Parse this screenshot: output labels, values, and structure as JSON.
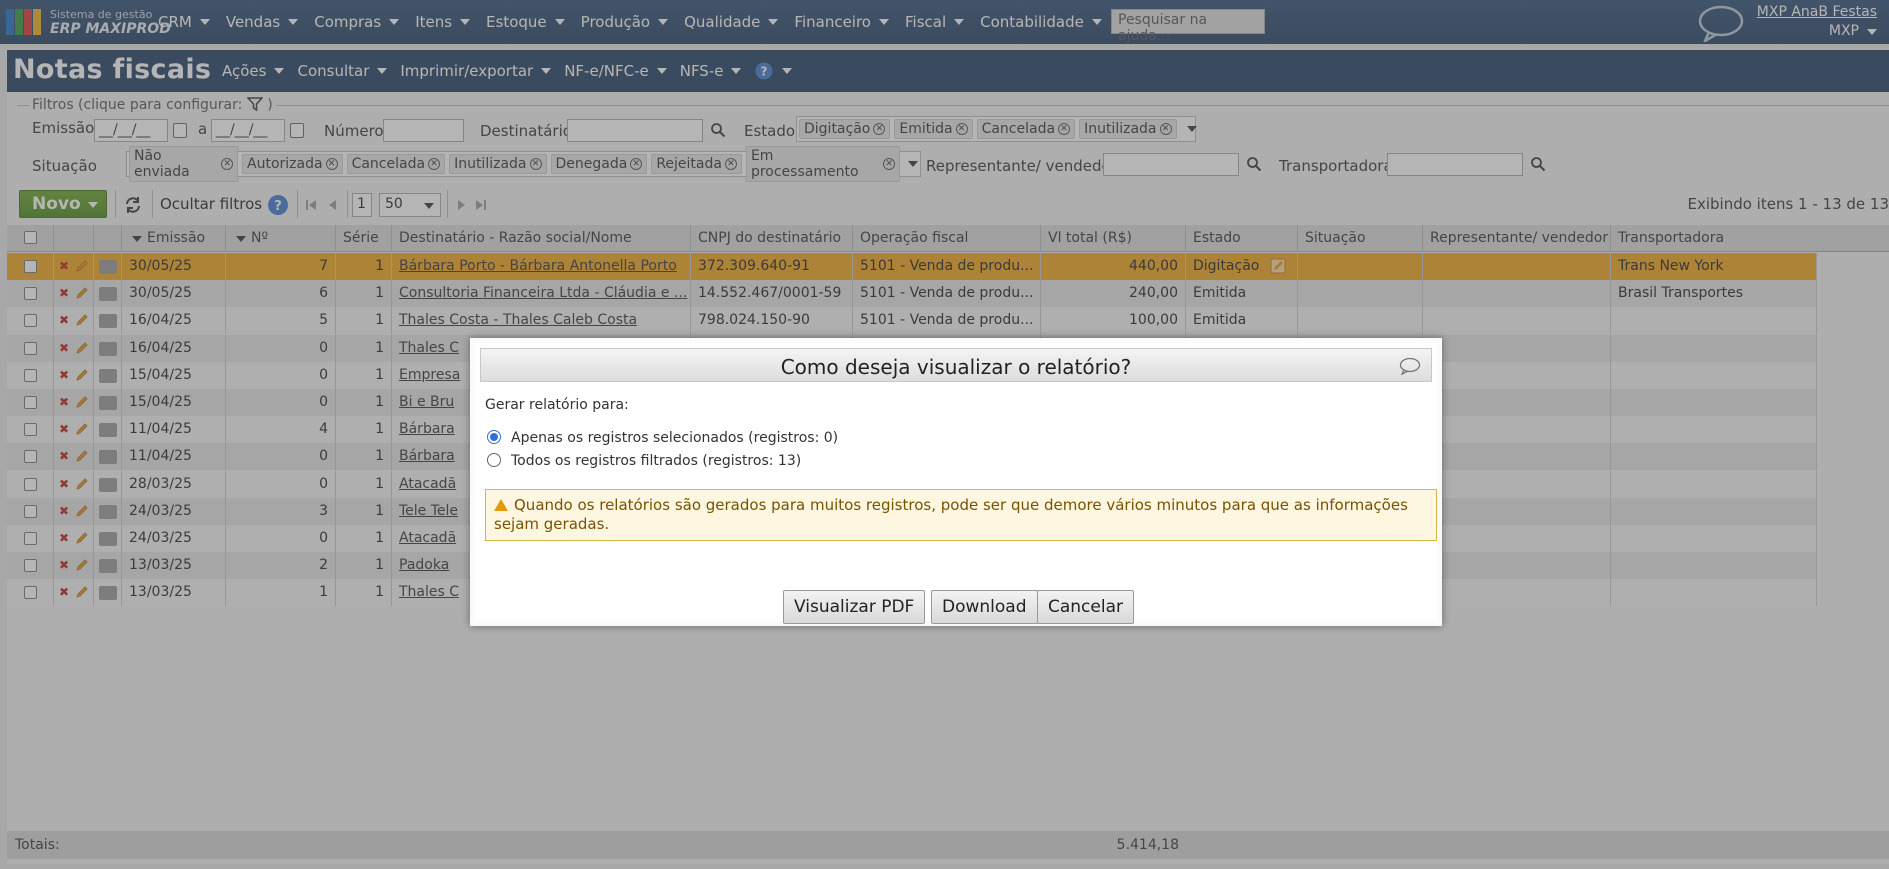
{
  "topbar": {
    "logo_sub": "Sistema de gestão",
    "logo_main": "ERP MAXIPROD",
    "nav": [
      "CRM",
      "Vendas",
      "Compras",
      "Itens",
      "Estoque",
      "Produção",
      "Qualidade",
      "Financeiro",
      "Fiscal",
      "Contabilidade"
    ],
    "help_search_placeholder": "Pesquisar na ajuda...",
    "user_name": "MXP AnaB Festas",
    "company": "MXP"
  },
  "page": {
    "title": "Notas fiscais",
    "menu": [
      "Ações",
      "Consultar",
      "Imprimir/exportar",
      "NF-e/NFC-e",
      "NFS-e"
    ]
  },
  "filters": {
    "legend": "Filtros (clique para configurar:",
    "legend_close": ")",
    "emissao_label": "Emissão",
    "date_placeholder": "__/__/__",
    "a_label": "a",
    "numero_label": "Número",
    "destinatario_label": "Destinatário",
    "estado_label": "Estado",
    "estado_tags": [
      "Digitação",
      "Emitida",
      "Cancelada",
      "Inutilizada"
    ],
    "situacao_label": "Situação",
    "situacao_tags": [
      "Não enviada",
      "Autorizada",
      "Cancelada",
      "Inutilizada",
      "Denegada",
      "Rejeitada",
      "Em processamento"
    ],
    "representante_label": "Representante/ vendedor",
    "transportadora_label": "Transportadora"
  },
  "toolbar": {
    "novo_label": "Novo",
    "hide_filters_label": "Ocultar filtros",
    "page_number": "1",
    "page_size": "50",
    "showing": "Exibindo itens 1 - 13 de 13"
  },
  "grid": {
    "headers": {
      "emissao": "Emissão",
      "numero": "Nº",
      "serie": "Série",
      "destinatario": "Destinatário - Razão social/Nome",
      "cnpj": "CNPJ do destinatário",
      "operacao": "Operação fiscal",
      "total": "Vl total (R$)",
      "estado": "Estado",
      "situacao": "Situação",
      "representante": "Representante/ vendedor",
      "transportadora": "Transportadora"
    },
    "rows": [
      {
        "emissao": "30/05/25",
        "numero": "7",
        "serie": "1",
        "destinatario": "Bárbara Porto - Bárbara Antonella Porto",
        "cnpj": "372.309.640-91",
        "operacao": "5101 - Venda de produ...",
        "total": "440,00",
        "estado": "Digitação",
        "situacao": "",
        "representante": "",
        "transportadora": "Trans New York"
      },
      {
        "emissao": "30/05/25",
        "numero": "6",
        "serie": "1",
        "destinatario": "Consultoria Financeira Ltda - Cláudia e ...",
        "cnpj": "14.552.467/0001-59",
        "operacao": "5101 - Venda de produ...",
        "total": "240,00",
        "estado": "Emitida",
        "situacao": "",
        "representante": "",
        "transportadora": "Brasil Transportes"
      },
      {
        "emissao": "16/04/25",
        "numero": "5",
        "serie": "1",
        "destinatario": "Thales Costa - Thales Caleb Costa",
        "cnpj": "798.024.150-90",
        "operacao": "5101 - Venda de produ...",
        "total": "100,00",
        "estado": "Emitida",
        "situacao": "",
        "representante": "",
        "transportadora": ""
      },
      {
        "emissao": "16/04/25",
        "numero": "0",
        "serie": "1",
        "destinatario": "Thales C",
        "cnpj": "",
        "operacao": "",
        "total": "",
        "estado": "",
        "situacao": "",
        "representante": "",
        "transportadora": ""
      },
      {
        "emissao": "15/04/25",
        "numero": "0",
        "serie": "1",
        "destinatario": "Empresa",
        "cnpj": "",
        "operacao": "",
        "total": "",
        "estado": "",
        "situacao": "",
        "representante": "",
        "transportadora": ""
      },
      {
        "emissao": "15/04/25",
        "numero": "0",
        "serie": "1",
        "destinatario": "Bi e Bru",
        "cnpj": "",
        "operacao": "",
        "total": "",
        "estado": "",
        "situacao": "",
        "representante": "",
        "transportadora": ""
      },
      {
        "emissao": "11/04/25",
        "numero": "4",
        "serie": "1",
        "destinatario": "Bárbara",
        "cnpj": "",
        "operacao": "",
        "total": "",
        "estado": "",
        "situacao": "",
        "representante": "",
        "transportadora": ""
      },
      {
        "emissao": "11/04/25",
        "numero": "0",
        "serie": "1",
        "destinatario": "Bárbara",
        "cnpj": "",
        "operacao": "",
        "total": "",
        "estado": "",
        "situacao": "",
        "representante": "",
        "transportadora": ""
      },
      {
        "emissao": "28/03/25",
        "numero": "0",
        "serie": "1",
        "destinatario": "Atacadã",
        "cnpj": "",
        "operacao": "",
        "total": "",
        "estado": "",
        "situacao": "",
        "representante": "",
        "transportadora": ""
      },
      {
        "emissao": "24/03/25",
        "numero": "3",
        "serie": "1",
        "destinatario": "Tele Tele",
        "cnpj": "",
        "operacao": "",
        "total": "",
        "estado": "",
        "situacao": "",
        "representante": "",
        "transportadora": ""
      },
      {
        "emissao": "24/03/25",
        "numero": "0",
        "serie": "1",
        "destinatario": "Atacadã",
        "cnpj": "",
        "operacao": "",
        "total": "",
        "estado": "",
        "situacao": "",
        "representante": "",
        "transportadora": ""
      },
      {
        "emissao": "13/03/25",
        "numero": "2",
        "serie": "1",
        "destinatario": "Padoka",
        "cnpj": "",
        "operacao": "",
        "total": "",
        "estado": "",
        "situacao": "",
        "representante": "",
        "transportadora": ""
      },
      {
        "emissao": "13/03/25",
        "numero": "1",
        "serie": "1",
        "destinatario": "Thales C",
        "cnpj": "",
        "operacao": "",
        "total": "",
        "estado": "",
        "situacao": "",
        "representante": "",
        "transportadora": ""
      }
    ],
    "totals_label": "Totais:",
    "totals_value": "5.414,18"
  },
  "modal": {
    "title": "Como deseja visualizar o relatório?",
    "prompt": "Gerar relatório para:",
    "option_selected": "Apenas os registros selecionados (registros: 0)",
    "option_all": "Todos os registros filtrados (registros: 13)",
    "warning": "Quando os relatórios são gerados para muitos registros, pode ser que demore vários minutos para que as informações sejam geradas.",
    "btn_pdf": "Visualizar PDF",
    "btn_download": "Download",
    "btn_cancel": "Cancelar"
  },
  "colors": {
    "topbar": "#2b4a70",
    "page_head": "#1f3d63",
    "selected_row": "#f0a51c",
    "novo_button": "#5a9a22"
  }
}
